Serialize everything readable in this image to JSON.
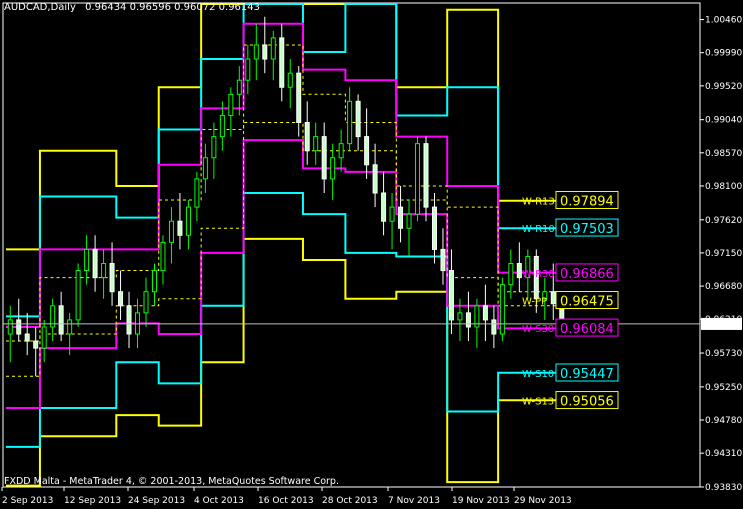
{
  "header": {
    "symbol": "AUDCAD,Daily",
    "ohlc": "0.96434 0.96596 0.96072 0.96143"
  },
  "watermark": "FXDD Malta - MetaTrader 4, © 2001-2013, MetaQuotes Software Corp.",
  "current_price_label": "0.96143",
  "colors": {
    "background": "#000000",
    "frame": "#ffffff",
    "bull_candle": "#00ff00",
    "bear_candle": "#ffffff",
    "candle_body_fill": "#c8ffc8",
    "yellow": "#ffff00",
    "cyan": "#00ffff",
    "magenta": "#ff00ff",
    "dashed_yellow": "#ffff00"
  },
  "chart_data": {
    "type": "line",
    "title": "AUDCAD,Daily",
    "ylim": [
      0.9383,
      1.00695
    ],
    "y_ticks": [
      "1.00460",
      "0.99990",
      "0.99520",
      "0.99040",
      "0.98570",
      "0.98100",
      "0.97620",
      "0.97150",
      "0.96680",
      "0.96210",
      "0.95730",
      "0.95250",
      "0.94780",
      "0.94310",
      "0.93830"
    ],
    "x_tick_labels": [
      "2 Sep 2013",
      "12 Sep 2013",
      "24 Sep 2013",
      "4 Oct 2013",
      "16 Oct 2013",
      "28 Oct 2013",
      "7 Nov 2013",
      "19 Nov 2013",
      "29 Nov 2013"
    ],
    "bars": 66,
    "weeks": [
      {
        "start": 0,
        "end": 4,
        "y_hi": 0.972,
        "c_hi": 0.9625,
        "m_hi": 0.961,
        "d_hi": 0.959,
        "d_lo": 0.954,
        "m_lo": 0.9495,
        "c_lo": 0.944,
        "y_lo": 0.9385
      },
      {
        "start": 4,
        "end": 13,
        "y_hi": 0.986,
        "c_hi": 0.9795,
        "m_hi": 0.972,
        "d_hi": 0.968,
        "d_lo": 0.96,
        "m_lo": 0.958,
        "c_lo": 0.9495,
        "y_lo": 0.9455
      },
      {
        "start": 13,
        "end": 18,
        "y_hi": 0.981,
        "c_hi": 0.9765,
        "m_hi": 0.972,
        "d_hi": 0.969,
        "d_lo": 0.964,
        "m_lo": 0.9615,
        "c_lo": 0.956,
        "y_lo": 0.9485
      },
      {
        "start": 18,
        "end": 23,
        "y_hi": 0.995,
        "c_hi": 0.989,
        "m_hi": 0.984,
        "d_hi": 0.979,
        "d_lo": 0.965,
        "m_lo": 0.96,
        "c_lo": 0.953,
        "y_lo": 0.947
      },
      {
        "start": 23,
        "end": 28,
        "y_hi": 1.007,
        "c_hi": 0.999,
        "m_hi": 0.992,
        "d_hi": 0.989,
        "d_lo": 0.975,
        "m_lo": 0.9715,
        "c_lo": 0.964,
        "y_lo": 0.956
      },
      {
        "start": 28,
        "end": 35,
        "y_hi": 1.007,
        "c_hi": 1.007,
        "m_hi": 1.004,
        "d_hi": 1.001,
        "d_lo": 0.99,
        "m_lo": 0.9875,
        "c_lo": 0.98,
        "y_lo": 0.9735
      },
      {
        "start": 35,
        "end": 40,
        "y_hi": 1.007,
        "c_hi": 1.0,
        "m_hi": 0.9975,
        "d_hi": 0.994,
        "d_lo": 0.986,
        "m_lo": 0.9835,
        "c_lo": 0.977,
        "y_lo": 0.9705
      },
      {
        "start": 40,
        "end": 46,
        "y_hi": 1.007,
        "c_hi": 1.007,
        "m_hi": 0.996,
        "d_hi": 0.99,
        "d_lo": 0.986,
        "m_lo": 0.983,
        "c_lo": 0.9715,
        "y_lo": 0.965
      },
      {
        "start": 46,
        "end": 52,
        "y_hi": 0.995,
        "c_hi": 0.991,
        "m_hi": 0.988,
        "d_hi": 0.981,
        "d_lo": 0.979,
        "m_lo": 0.977,
        "c_lo": 0.971,
        "y_lo": 0.966
      },
      {
        "start": 52,
        "end": 58,
        "y_hi": 1.006,
        "c_hi": 0.995,
        "m_hi": 0.981,
        "d_hi": 0.978,
        "d_lo": 0.968,
        "m_lo": 0.964,
        "c_lo": 0.949,
        "y_lo": 0.939
      },
      {
        "start": 58,
        "end": 66,
        "y_hi": 0.9789,
        "c_hi": 0.975,
        "m_hi": 0.9687,
        "d_hi": 0.966,
        "d_lo": 0.964,
        "m_lo": 0.9608,
        "c_lo": 0.9545,
        "y_lo": 0.9506
      }
    ],
    "candles": [
      [
        0.96,
        0.964,
        0.956,
        0.962
      ],
      [
        0.962,
        0.965,
        0.959,
        0.96
      ],
      [
        0.96,
        0.963,
        0.957,
        0.959
      ],
      [
        0.959,
        0.961,
        0.954,
        0.958
      ],
      [
        0.958,
        0.962,
        0.956,
        0.961
      ],
      [
        0.961,
        0.965,
        0.959,
        0.964
      ],
      [
        0.964,
        0.966,
        0.959,
        0.96
      ],
      [
        0.96,
        0.963,
        0.957,
        0.962
      ],
      [
        0.962,
        0.97,
        0.961,
        0.969
      ],
      [
        0.969,
        0.974,
        0.967,
        0.972
      ],
      [
        0.972,
        0.974,
        0.966,
        0.968
      ],
      [
        0.968,
        0.972,
        0.965,
        0.97
      ],
      [
        0.97,
        0.973,
        0.964,
        0.966
      ],
      [
        0.966,
        0.969,
        0.962,
        0.964
      ],
      [
        0.964,
        0.966,
        0.958,
        0.96
      ],
      [
        0.96,
        0.965,
        0.958,
        0.963
      ],
      [
        0.963,
        0.968,
        0.961,
        0.966
      ],
      [
        0.966,
        0.97,
        0.964,
        0.969
      ],
      [
        0.969,
        0.974,
        0.967,
        0.973
      ],
      [
        0.973,
        0.978,
        0.97,
        0.976
      ],
      [
        0.976,
        0.98,
        0.972,
        0.974
      ],
      [
        0.974,
        0.979,
        0.972,
        0.978
      ],
      [
        0.978,
        0.983,
        0.976,
        0.982
      ],
      [
        0.982,
        0.987,
        0.98,
        0.985
      ],
      [
        0.985,
        0.99,
        0.982,
        0.988
      ],
      [
        0.988,
        0.993,
        0.986,
        0.991
      ],
      [
        0.991,
        0.995,
        0.988,
        0.994
      ],
      [
        0.994,
        0.998,
        0.991,
        0.996
      ],
      [
        0.996,
        1.001,
        0.994,
        0.999
      ],
      [
        0.999,
        1.004,
        0.996,
        1.001
      ],
      [
        1.001,
        1.005,
        0.997,
        0.999
      ],
      [
        0.999,
        1.003,
        0.996,
        1.002
      ],
      [
        1.002,
        1.004,
        0.993,
        0.995
      ],
      [
        0.995,
        0.999,
        0.992,
        0.997
      ],
      [
        0.997,
        0.998,
        0.988,
        0.99
      ],
      [
        0.99,
        0.993,
        0.984,
        0.986
      ],
      [
        0.986,
        0.99,
        0.984,
        0.988
      ],
      [
        0.988,
        0.99,
        0.98,
        0.982
      ],
      [
        0.982,
        0.987,
        0.979,
        0.985
      ],
      [
        0.985,
        0.989,
        0.983,
        0.987
      ],
      [
        0.987,
        0.995,
        0.986,
        0.993
      ],
      [
        0.993,
        0.994,
        0.986,
        0.988
      ],
      [
        0.988,
        0.992,
        0.982,
        0.984
      ],
      [
        0.984,
        0.987,
        0.978,
        0.98
      ],
      [
        0.98,
        0.983,
        0.974,
        0.976
      ],
      [
        0.976,
        0.98,
        0.972,
        0.978
      ],
      [
        0.978,
        0.981,
        0.973,
        0.975
      ],
      [
        0.975,
        0.979,
        0.971,
        0.977
      ],
      [
        0.977,
        0.988,
        0.976,
        0.987
      ],
      [
        0.987,
        0.988,
        0.976,
        0.978
      ],
      [
        0.978,
        0.98,
        0.97,
        0.972
      ],
      [
        0.972,
        0.975,
        0.967,
        0.969
      ],
      [
        0.969,
        0.972,
        0.96,
        0.962
      ],
      [
        0.962,
        0.965,
        0.959,
        0.963
      ],
      [
        0.963,
        0.966,
        0.959,
        0.961
      ],
      [
        0.961,
        0.965,
        0.958,
        0.964
      ],
      [
        0.964,
        0.967,
        0.959,
        0.962
      ],
      [
        0.962,
        0.964,
        0.958,
        0.96
      ],
      [
        0.96,
        0.968,
        0.959,
        0.967
      ],
      [
        0.967,
        0.972,
        0.965,
        0.97
      ],
      [
        0.97,
        0.973,
        0.966,
        0.968
      ],
      [
        0.968,
        0.972,
        0.965,
        0.971
      ],
      [
        0.971,
        0.972,
        0.963,
        0.965
      ],
      [
        0.965,
        0.968,
        0.962,
        0.966
      ],
      [
        0.966,
        0.97,
        0.962,
        0.9643
      ],
      [
        0.9643,
        0.966,
        0.9607,
        0.9614
      ]
    ],
    "levels": [
      {
        "tag": "W-R13",
        "value": "0.97894",
        "color": "#ffff00"
      },
      {
        "tag": "W-R10",
        "value": "0.97503",
        "color": "#00ffff"
      },
      {
        "tag": "W-R38",
        "value": "0.96866",
        "color": "#ff00ff"
      },
      {
        "tag": "W-PP",
        "value": "0.96475",
        "color": "#ffff00"
      },
      {
        "tag": "W-S38",
        "value": "0.96084",
        "color": "#ff00ff"
      },
      {
        "tag": "W-S10",
        "value": "0.95447",
        "color": "#00ffff"
      },
      {
        "tag": "W-S13",
        "value": "0.95056",
        "color": "#ffff00"
      }
    ]
  }
}
